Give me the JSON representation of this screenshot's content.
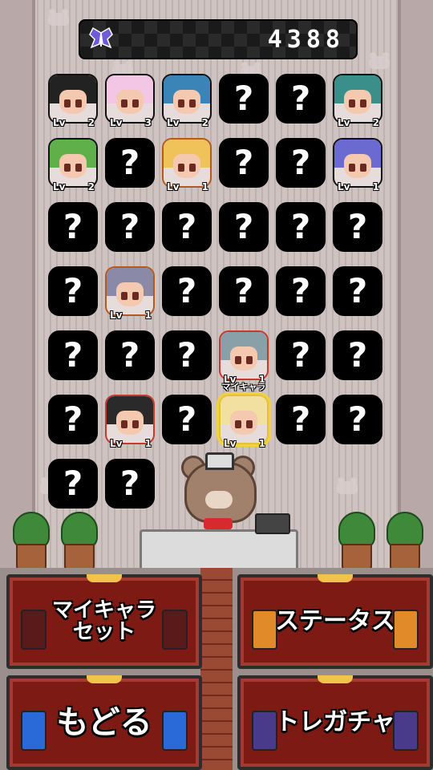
{
  "header": {
    "currency_icon": "butterfly-icon",
    "currency_value": "4388"
  },
  "grid": {
    "rows": [
      [
        {
          "type": "char",
          "level_label": "Lv",
          "level": "2",
          "hair": "#222",
          "frame": "#111"
        },
        {
          "type": "char",
          "level_label": "Lv",
          "level": "3",
          "hair": "#f3c6e6",
          "frame": "#111"
        },
        {
          "type": "char",
          "level_label": "Lv",
          "level": "2",
          "hair": "#3b84b8",
          "frame": "#111"
        },
        {
          "type": "unknown",
          "glyph": "?"
        },
        {
          "type": "unknown",
          "glyph": "?"
        },
        {
          "type": "char",
          "level_label": "Lv",
          "level": "2",
          "hair": "#3a8f8a",
          "frame": "#111"
        }
      ],
      [
        {
          "type": "char",
          "level_label": "Lv",
          "level": "2",
          "hair": "#5fb04a",
          "frame": "#111"
        },
        {
          "type": "unknown",
          "glyph": "?"
        },
        {
          "type": "char",
          "level_label": "Lv",
          "level": "1",
          "hair": "#f0c25a",
          "frame": "#b55a1a"
        },
        {
          "type": "unknown",
          "glyph": "?"
        },
        {
          "type": "unknown",
          "glyph": "?"
        },
        {
          "type": "char",
          "level_label": "Lv",
          "level": "1",
          "hair": "#6a6ad0",
          "frame": "#111"
        }
      ],
      [
        {
          "type": "unknown",
          "glyph": "?"
        },
        {
          "type": "unknown",
          "glyph": "?"
        },
        {
          "type": "unknown",
          "glyph": "?"
        },
        {
          "type": "unknown",
          "glyph": "?"
        },
        {
          "type": "unknown",
          "glyph": "?"
        },
        {
          "type": "unknown",
          "glyph": "?"
        }
      ],
      [
        {
          "type": "unknown",
          "glyph": "?"
        },
        {
          "type": "char",
          "level_label": "Lv",
          "level": "1",
          "hair": "#8a8aa8",
          "frame": "#b55a1a"
        },
        {
          "type": "unknown",
          "glyph": "?"
        },
        {
          "type": "unknown",
          "glyph": "?"
        },
        {
          "type": "unknown",
          "glyph": "?"
        },
        {
          "type": "unknown",
          "glyph": "?"
        }
      ],
      [
        {
          "type": "unknown",
          "glyph": "?"
        },
        {
          "type": "unknown",
          "glyph": "?"
        },
        {
          "type": "unknown",
          "glyph": "?"
        },
        {
          "type": "char",
          "level_label": "Lv",
          "level": "1",
          "hair": "#8aa0a8",
          "frame": "#c73a2a"
        },
        {
          "type": "unknown",
          "glyph": "?"
        },
        {
          "type": "unknown",
          "glyph": "?"
        }
      ],
      [
        {
          "type": "unknown",
          "glyph": "?"
        },
        {
          "type": "char",
          "level_label": "Lv",
          "level": "1",
          "hair": "#2a2a2a",
          "frame": "#c73a2a"
        },
        {
          "type": "unknown",
          "glyph": "?"
        },
        {
          "type": "char",
          "level_label": "Lv",
          "level": "1",
          "hair": "#f1e0a0",
          "frame": "#e2c23a",
          "tag": "マイキャラ",
          "selected": true
        },
        {
          "type": "unknown",
          "glyph": "?"
        },
        {
          "type": "unknown",
          "glyph": "?"
        }
      ],
      [
        {
          "type": "unknown",
          "glyph": "?"
        },
        {
          "type": "unknown",
          "glyph": "?"
        }
      ]
    ]
  },
  "menu": {
    "set_mychara": "マイキャラ\nセット",
    "status": "ステータス",
    "back": "もどる",
    "training_gacha": "トレガチャ"
  },
  "colors": {
    "menu_panel": "#7e1a14",
    "score_bar": "#1a1a1a",
    "selected_outline": "#f2d23a"
  }
}
